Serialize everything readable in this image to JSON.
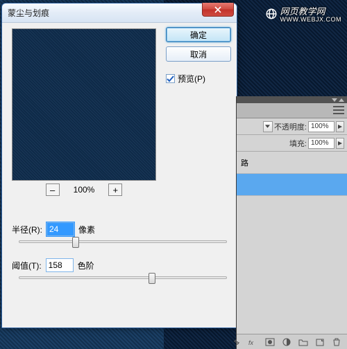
{
  "watermark": {
    "brand": "网页教学网",
    "url": "WWW.WEBJX.COM"
  },
  "dialog": {
    "title": "蒙尘与划痕",
    "ok": "确定",
    "cancel": "取消",
    "preview_label": "预览(P)",
    "preview_checked": true,
    "zoom_pct": "100%",
    "zoom_out": "–",
    "zoom_in": "+",
    "radius_label": "半径(R):",
    "radius_value": "24",
    "radius_unit": "像素",
    "threshold_label": "阈值(T):",
    "threshold_value": "158",
    "threshold_unit": "色阶"
  },
  "layers": {
    "opacity_label": "不透明度:",
    "opacity_value": "100%",
    "fill_label": "填充:",
    "fill_value": "100%",
    "item_unsel": "路",
    "item_sel": ""
  }
}
